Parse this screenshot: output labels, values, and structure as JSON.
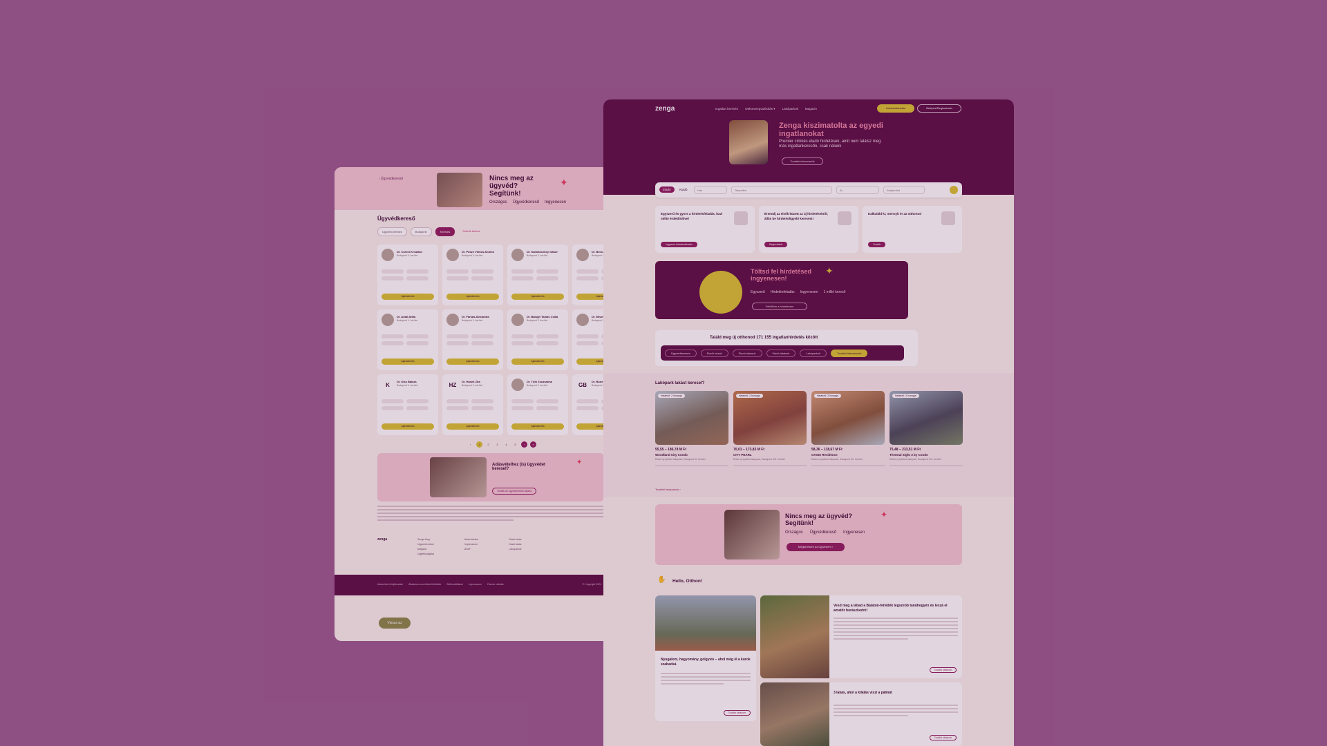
{
  "left": {
    "breadcrumb": "‹ Ügyvédkereső",
    "hero": {
      "title": "Nincs meg az ügyvéd? Segítünk!",
      "tags": [
        "Országos",
        "Ügyvédkereső",
        "Ingyenesen"
      ]
    },
    "heading": "Ügyvédkereső",
    "filters": [
      "Ügyvéd keresés",
      "Budapest",
      "Keresés"
    ],
    "clear_label": "Szűrők törlése",
    "lawyers": [
      {
        "name": "Dr. Cserni Krisztián",
        "initials": ""
      },
      {
        "name": "Dr. Pösze Vilmos Andrea",
        "initials": ""
      },
      {
        "name": "Dr. Kálmánczhey Gábor",
        "initials": ""
      },
      {
        "name": "Dr. Bencz",
        "initials": ""
      },
      {
        "name": "Dr. Antal Attila",
        "initials": ""
      },
      {
        "name": "Dr. Farkas Alexandra",
        "initials": ""
      },
      {
        "name": "Dr. Balogh Tamás Csilla",
        "initials": ""
      },
      {
        "name": "Dr. Mézes",
        "initials": ""
      },
      {
        "name": "Dr. Kiss Balázs",
        "initials": "K"
      },
      {
        "name": "Dr. Húsek Zita",
        "initials": "HZ"
      },
      {
        "name": "Dr. Tóth Zsuzsanna",
        "initials": ""
      },
      {
        "name": "Dr. Bóné",
        "initials": "GB"
      }
    ],
    "location": "Budapest V. kerület",
    "card_button": "Ajánlatkérés",
    "pager": [
      "‹",
      "1",
      "2",
      "3",
      "4",
      "5",
      "›",
      "»"
    ],
    "promo_title": "Adásvételhez (is) ügyvédet keresel?",
    "promo_button": "Tovább az ügyvédkereső oldalra",
    "footer_logo": "zenga",
    "footer_cols": [
      [
        "Zenga blog",
        "Ügyvéd kereső",
        "Magazin",
        "Ügyfélszolgálat"
      ],
      [
        "Adatvédelem",
        "Impresszum",
        "ÁSZF"
      ],
      [
        "Eladó lakás",
        "Kiadó lakás",
        "Lakóparkok"
      ]
    ],
    "bar_links": [
      "Adatvédelmi tájékoztató",
      "Általános szerződési feltételek",
      "Süti beállítások",
      "Impresszum",
      "Partner oldalak"
    ],
    "copyright": "© Copyright 2024",
    "back_button": "Vissza az"
  },
  "right": {
    "logo": "zenga",
    "nav": [
      "Ingatlan keresés",
      "Otthonmegvalósítás ▾",
      "Lakóparkok",
      "Magazin"
    ],
    "post_button": "Hirdetésfeladás",
    "login_button": "Belépés/Regisztráció",
    "hero": {
      "title": "Zenga kiszimatolta az egyedi ingatlanokat",
      "subtitle": "Premier címkés eladó hirdetések, amit nem találsz meg más ingatlankeresőn, csak nálunk",
      "button": "További információk"
    },
    "search": {
      "tab_on": "Eladó",
      "tab_off": "Kiadó",
      "type": "Ház",
      "location_placeholder": "Település",
      "price": "Ár",
      "size": "Alapterület"
    },
    "features": [
      {
        "text": "Egyszerű és gyors a hirdetésfeladás, havi millió érdeklődővel",
        "button": "Ingyenes hirdetésfeladás"
      },
      {
        "text": "Értesülj az elsők között az új hirdetésekről, állíts be hirdetésfigyelő keresést!",
        "button": "Regisztrálok"
      },
      {
        "text": "Kalkuláld ki, mennyit ér az otthonod",
        "button": "Tovább"
      }
    ],
    "upload": {
      "title": "Töltsd fel hirdetésed ingyenesen!",
      "features": [
        "Egyszerű",
        "Hirdetésfeladás",
        "Ingyenesen",
        "1 millió kereső"
      ],
      "button": "Feltöltöm a hirdetésem"
    },
    "count_title": "Találd meg új otthonod 171 155 ingatlanhirdetés között",
    "quick": [
      "Ügyvédkeresés",
      "Eladó házak",
      "Eladó lakások",
      "Kiadó lakások",
      "Lakóparkok",
      "További információk"
    ],
    "newbuild_title": "Lakópark lakást keresel?",
    "properties": [
      {
        "badge": "Határidő: 2 hónapja",
        "price": "55,55 – 186,78 M Ft",
        "name": "Woodland City Condo",
        "addr": "Eladó új építésű lakópark, Budapest XI. kerület"
      },
      {
        "badge": "Határidő: 2 hónapja",
        "price": "70,01 – 173,83 M Ft",
        "name": "CITY PEARL",
        "addr": "Eladó új építésű lakópark, Budapest XIII. kerület"
      },
      {
        "badge": "Határidő: 2 hónapja",
        "price": "58,36 – 118,67 M Ft",
        "name": "OASIS Residence",
        "addr": "Eladó új építésű lakópark, Budapest XII. kerület"
      },
      {
        "badge": "Határidő: 2 hónapja",
        "price": "75,48 – 233,51 M Ft",
        "name": "Thermal Sight 3 by Condo",
        "addr": "Eladó új építésű lakópark, Budapest XIV. kerület"
      }
    ],
    "more_link": "További lakóparkok ›",
    "lawyer": {
      "title": "Nincs meg az ügyvéd? Segítünk!",
      "features": [
        "Országos",
        "Ügyvédkereső",
        "Ingyenesen"
      ],
      "button": "Megkeresem az ügyvédem ›"
    },
    "hello": "Hello, Otthon!",
    "blog": [
      {
        "title": "Nyugalom, hagyomány, golgyvis – ahol még él a kurok szabadsá",
        "button": "Tovább olvasom"
      },
      {
        "title": "Vesd meg a lábad a Balaton-felvidék legszebb tanúhegyén és leszá el amatőr borászkodni!",
        "button": "Tovább olvasom"
      },
      {
        "title": "3 lakás, ahol a kilátás viszi a pálmát",
        "button": "Tovább olvasom"
      }
    ]
  },
  "colors": {
    "brand": "#5b0d44",
    "accent": "#8f1b5d",
    "yellow": "#d8c230",
    "pink": "#f3c9d3",
    "backdrop": "#9a5a8e"
  }
}
